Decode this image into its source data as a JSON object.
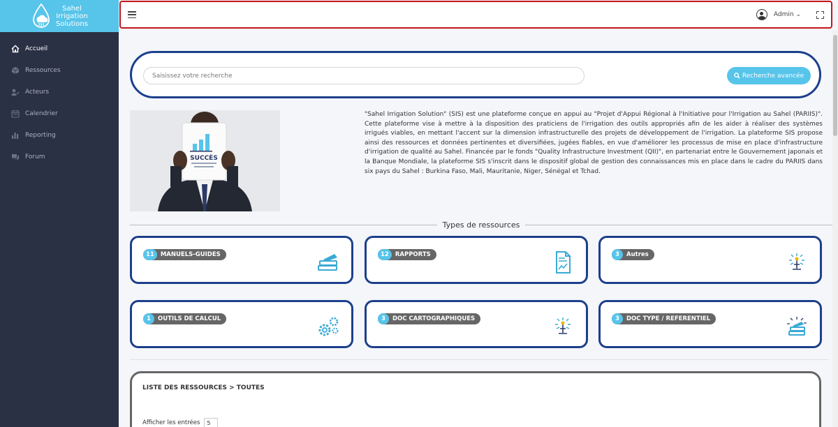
{
  "brand": {
    "line1": "Sahel",
    "line2": "Irrigation",
    "line3": "Solutions",
    "color": "#57c4ea"
  },
  "sidebar": {
    "items": [
      {
        "label": "Accueil",
        "icon": "home-icon"
      },
      {
        "label": "Ressources",
        "icon": "cube-icon"
      },
      {
        "label": "Acteurs",
        "icon": "users-icon"
      },
      {
        "label": "Calendrier",
        "icon": "calendar-icon"
      },
      {
        "label": "Reporting",
        "icon": "bar-chart-icon"
      },
      {
        "label": "Forum",
        "icon": "comments-icon"
      }
    ]
  },
  "topbar": {
    "user_label": "Admin ⌄",
    "menu_icon": "hamburger-icon",
    "fullscreen_icon": "fullscreen-icon",
    "user_icon": "user-circle-icon"
  },
  "search": {
    "placeholder": "Saisissez votre recherche",
    "value": "",
    "advanced_label": "Recherche avancée"
  },
  "hero": {
    "card_title": "SUCCÈS"
  },
  "intro": {
    "text": "\"Sahel Irrigation Solution\" (SIS) est une plateforme conçue en appui au \"Projet d'Appui Régional à l'Initiative pour l'Irrigation au Sahel (PARIIS)\". Cette plateforme vise à mettre à la disposition des praticiens de l'irrigation des outils appropriés afin de les aider à réaliser des systèmes irrigués viables, en mettant l'accent sur la dimension infrastructurelle des projets de développement de l'irrigation. La plateforme SIS propose ainsi des ressources et données pertinentes et diversifiées, jugées fiables, en vue d'améliorer les processus de mise en place d'infrastructure d'irrigation de qualité au Sahel. Financée par le fonds \"Quality Infrastructure Investment (QII)\", en partenariat entre le Gouvernement japonais et la Banque Mondiale, la plateforme SIS s'inscrit dans le dispositif global de gestion des connaissances mis en place dans le cadre du PARIIS dans six pays du Sahel : Burkina Faso, Mali, Mauritanie, Niger, Sénégal et Tchad."
  },
  "types": {
    "title": "Types de ressources",
    "items": [
      {
        "count": "11",
        "label": "MANUELS-GUIDES",
        "icon": "books-icon"
      },
      {
        "count": "12",
        "label": "RAPPORTS",
        "icon": "report-document-icon"
      },
      {
        "count": "3",
        "label": "Autres",
        "icon": "irrigation-sprinkler-icon"
      },
      {
        "count": "1",
        "label": "OUTILS DE CALCUL",
        "icon": "gears-icon"
      },
      {
        "count": "3",
        "label": "DOC CARTOGRAPHIQUES",
        "icon": "irrigation-sprinkler-icon"
      },
      {
        "count": "3",
        "label": "DOC TYPE / REFERENTIEL",
        "icon": "books-sparkle-icon"
      }
    ]
  },
  "resources": {
    "title": "LISTE DES RESSOURCES > TOUTES",
    "entries_label": "Afficher les entrées",
    "entries_value": "5"
  },
  "colors": {
    "sidebar": "#2b3145",
    "accent": "#57c4ea",
    "card_border": "#1c3f8c",
    "topbar_border": "#c4161c"
  }
}
